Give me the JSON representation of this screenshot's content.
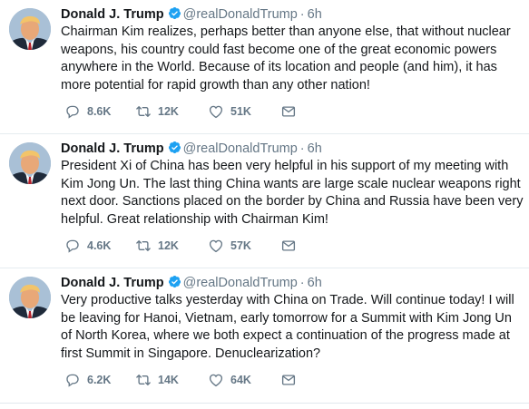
{
  "tweets": [
    {
      "author_name": "Donald J. Trump",
      "handle": "@realDonaldTrump",
      "separator": "·",
      "time": "6h",
      "text": "Chairman Kim realizes, perhaps better than anyone else, that without nuclear weapons, his country could fast become one of the great economic powers anywhere in the World. Because of its location and people (and him), it has more potential for rapid growth than any other nation!",
      "replies": "8.6K",
      "retweets": "12K",
      "likes": "51K"
    },
    {
      "author_name": "Donald J. Trump",
      "handle": "@realDonaldTrump",
      "separator": "·",
      "time": "6h",
      "text": "President Xi of China has been very helpful in his support of my meeting with Kim Jong Un. The last thing China wants are large scale nuclear weapons right next door. Sanctions placed on the border by China and Russia have been very helpful. Great relationship with Chairman Kim!",
      "replies": "4.6K",
      "retweets": "12K",
      "likes": "57K"
    },
    {
      "author_name": "Donald J. Trump",
      "handle": "@realDonaldTrump",
      "separator": "·",
      "time": "6h",
      "text": "Very productive talks yesterday with China on Trade. Will continue today! I will be leaving for Hanoi, Vietnam, early tomorrow for a Summit with Kim Jong Un of North Korea, where we both expect a continuation of the progress made at first Summit in Singapore. Denuclearization?",
      "replies": "6.2K",
      "retweets": "14K",
      "likes": "64K"
    }
  ],
  "icons": {
    "reply": "reply-icon",
    "retweet": "retweet-icon",
    "like": "heart-icon",
    "dm": "envelope-icon",
    "verified": "verified-badge-icon"
  },
  "colors": {
    "text": "#14171a",
    "secondary": "#657786",
    "verified": "#1da1f2",
    "divider": "#e6ecf0"
  }
}
